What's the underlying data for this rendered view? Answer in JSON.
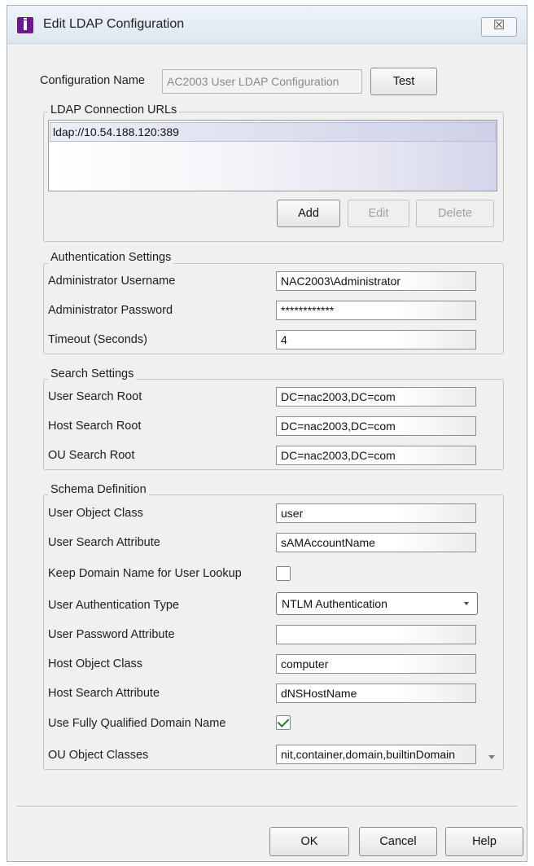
{
  "window": {
    "title": "Edit LDAP Configuration",
    "close_glyph": "☒"
  },
  "config": {
    "name_label": "Configuration Name",
    "name_value": "AC2003 User LDAP Configuration",
    "test_label": "Test"
  },
  "ldap_urls": {
    "legend": "LDAP Connection URLs",
    "items": [
      "ldap://10.54.188.120:389"
    ],
    "add_label": "Add",
    "edit_label": "Edit",
    "delete_label": "Delete"
  },
  "auth": {
    "legend": "Authentication Settings",
    "username_label": "Administrator Username",
    "username_value": "NAC2003\\Administrator",
    "password_label": "Administrator Password",
    "password_value": "************",
    "timeout_label": "Timeout (Seconds)",
    "timeout_value": "4"
  },
  "search": {
    "legend": "Search Settings",
    "user_root_label": "User Search Root",
    "user_root_value": "DC=nac2003,DC=com",
    "host_root_label": "Host Search Root",
    "host_root_value": "DC=nac2003,DC=com",
    "ou_root_label": "OU Search Root",
    "ou_root_value": "DC=nac2003,DC=com"
  },
  "schema": {
    "legend": "Schema Definition",
    "user_object_class_label": "User Object Class",
    "user_object_class_value": "user",
    "user_search_attr_label": "User Search Attribute",
    "user_search_attr_value": "sAMAccountName",
    "keep_domain_label": "Keep Domain Name for User Lookup",
    "keep_domain_checked": false,
    "user_auth_type_label": "User Authentication Type",
    "user_auth_type_value": "NTLM Authentication",
    "user_password_attr_label": "User Password Attribute",
    "user_password_attr_value": "",
    "host_object_class_label": "Host Object Class",
    "host_object_class_value": "computer",
    "host_search_attr_label": "Host Search Attribute",
    "host_search_attr_value": "dNSHostName",
    "use_fqdn_label": "Use Fully Qualified Domain Name",
    "use_fqdn_checked": true,
    "ou_object_classes_label": "OU Object Classes",
    "ou_object_classes_value": "nit,container,domain,builtinDomain"
  },
  "footer": {
    "ok_label": "OK",
    "cancel_label": "Cancel",
    "help_label": "Help"
  },
  "colors": {
    "accent": "#6a1a8a",
    "check": "#2a7a2a"
  }
}
